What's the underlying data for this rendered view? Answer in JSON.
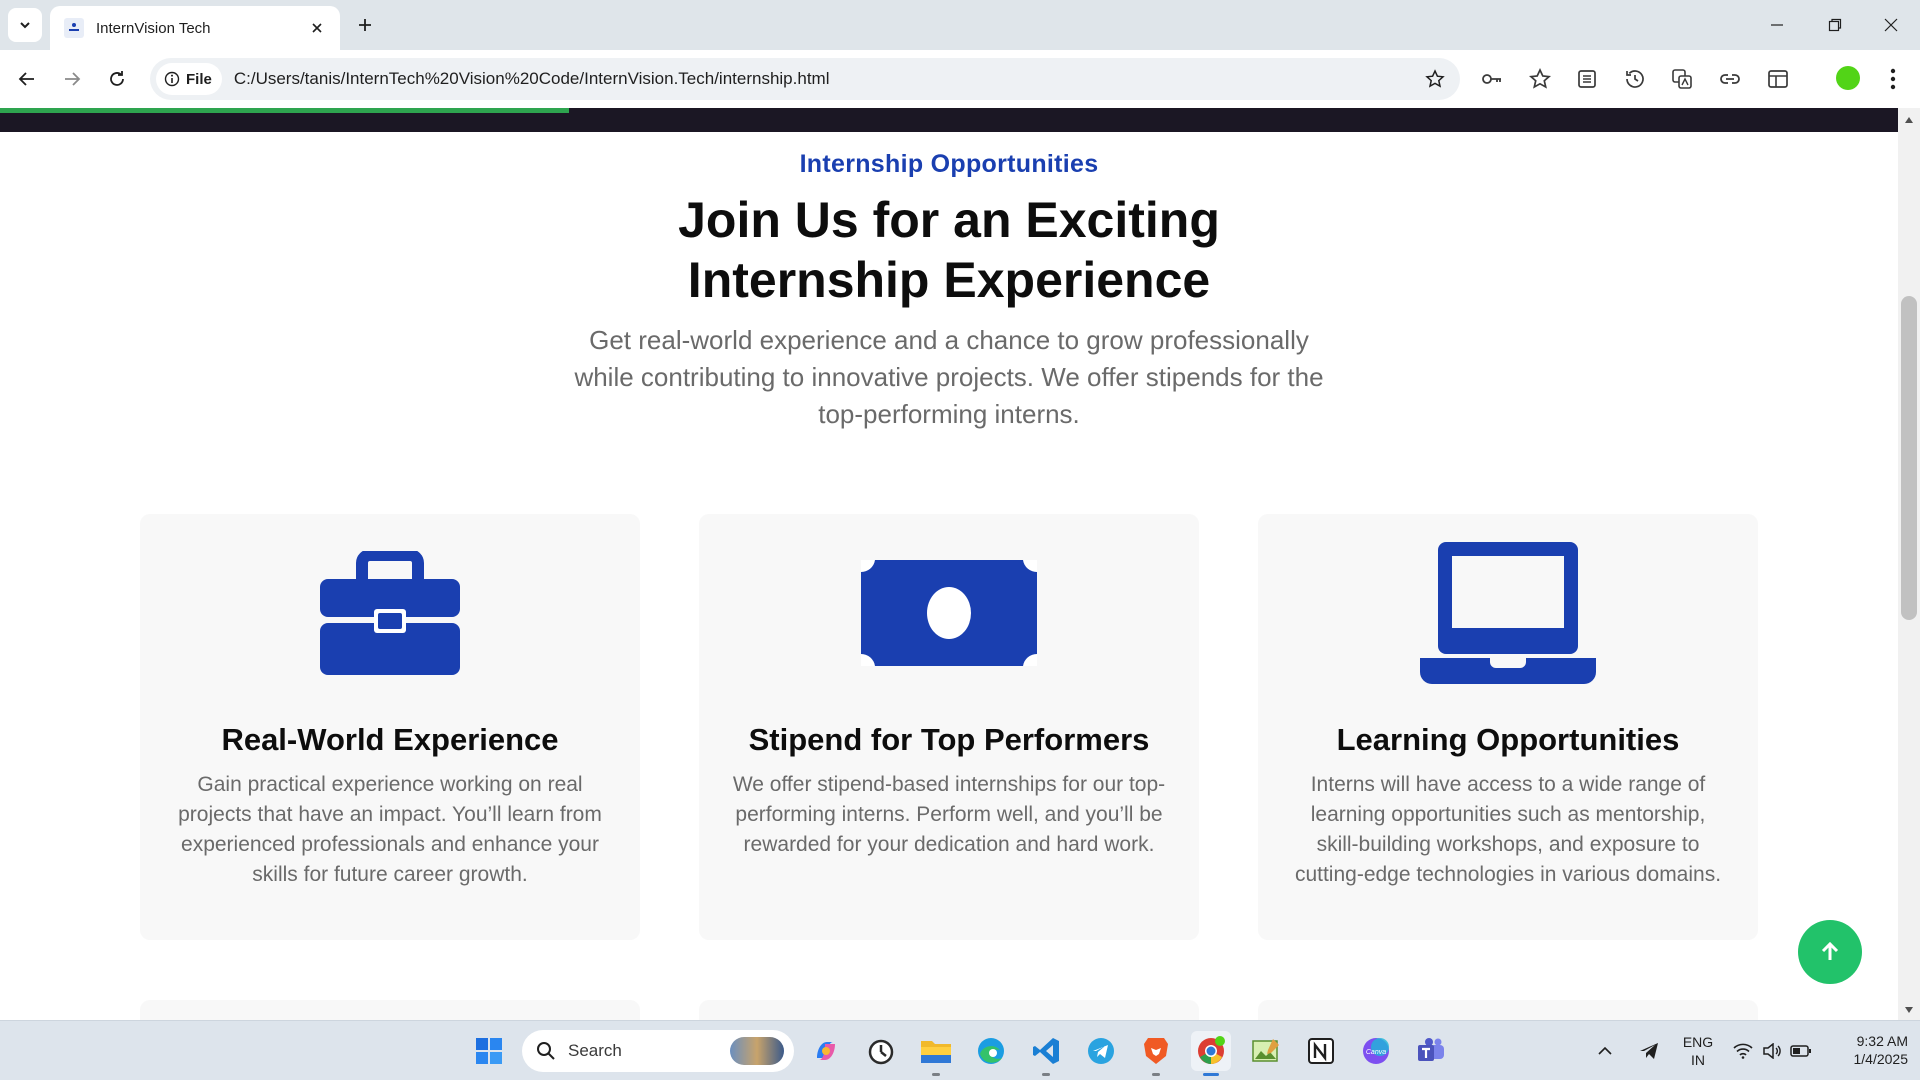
{
  "browser": {
    "tab_title": "InternVision Tech",
    "file_chip": "File",
    "url": "C:/Users/tanis/InternTech%20Vision%20Code/InternVision.Tech/internship.html",
    "load_progress_percent": 30
  },
  "hero": {
    "eyebrow": "Internship Opportunities",
    "headline_line1": "Join Us for an Exciting",
    "headline_line2": "Internship Experience",
    "lead": "Get real-world experience and a chance to grow professionally while contributing to innovative projects. We offer stipends for the top-performing interns."
  },
  "cards": [
    {
      "icon": "briefcase-icon",
      "title": "Real-World Experience",
      "text": "Gain practical experience working on real projects that have an impact. You’ll learn from experienced professionals and enhance your skills for future career growth."
    },
    {
      "icon": "money-bill-icon",
      "title": "Stipend for Top Performers",
      "text": "We offer stipend-based internships for our top-performing interns. Perform well, and you’ll be rewarded for your dedication and hard work."
    },
    {
      "icon": "laptop-icon",
      "title": "Learning Opportunities",
      "text": "Interns will have access to a wide range of learning opportunities such as mentorship, skill-building workshops, and exposure to cutting-edge technologies in various domains."
    }
  ],
  "colors": {
    "accent": "#1a3fb0",
    "scroll_top_button": "#22c26a"
  },
  "taskbar": {
    "search_label": "Search",
    "lang_line1": "ENG",
    "lang_line2": "IN",
    "time": "9:32 AM",
    "date": "1/4/2025"
  }
}
